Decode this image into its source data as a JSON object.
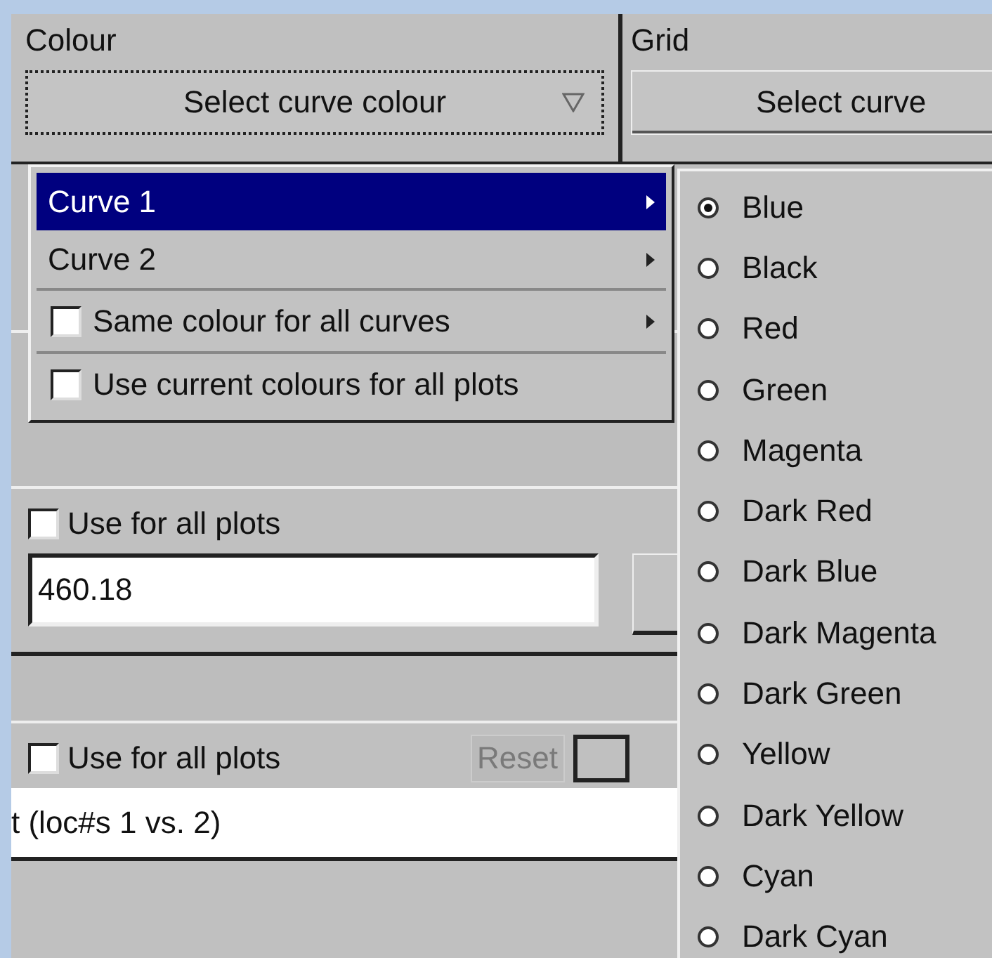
{
  "sections": [
    {
      "label": "Colour",
      "button": "Select curve colour",
      "focused": true
    },
    {
      "label": "Grid",
      "button": "Select curve",
      "focused": false
    }
  ],
  "menu": {
    "items": [
      {
        "kind": "item",
        "label": "Curve 1",
        "selected": true,
        "submenu": true
      },
      {
        "kind": "item",
        "label": "Curve 2",
        "selected": false,
        "submenu": true
      },
      {
        "kind": "check",
        "label": "Same colour for all curves",
        "selected": false,
        "checked": false,
        "submenu": true
      },
      {
        "kind": "check",
        "label": "Use current colours for all plots",
        "selected": false,
        "checked": false,
        "submenu": false
      }
    ]
  },
  "submenu": {
    "items": [
      {
        "label": "Blue",
        "selected": true
      },
      {
        "label": "Black",
        "selected": false
      },
      {
        "label": "Red",
        "selected": false
      },
      {
        "label": "Green",
        "selected": false
      },
      {
        "label": "Magenta",
        "selected": false
      },
      {
        "label": "Dark Red",
        "selected": false
      },
      {
        "label": "Dark Blue",
        "selected": false
      },
      {
        "label": "Dark Magenta",
        "selected": false
      },
      {
        "label": "Dark Green",
        "selected": false
      },
      {
        "label": "Yellow",
        "selected": false
      },
      {
        "label": "Dark Yellow",
        "selected": false
      },
      {
        "label": "Cyan",
        "selected": false
      },
      {
        "label": "Dark Cyan",
        "selected": false
      }
    ]
  },
  "panel_a": {
    "use_for_all": {
      "label": "Use for all plots",
      "checked": false
    },
    "value": "460.18"
  },
  "panel_b": {
    "use_for_all": {
      "label": "Use for all plots",
      "checked": false
    },
    "reset": {
      "label": "Reset",
      "disabled": true
    },
    "value": "t (loc#s 1 vs. 2)"
  }
}
